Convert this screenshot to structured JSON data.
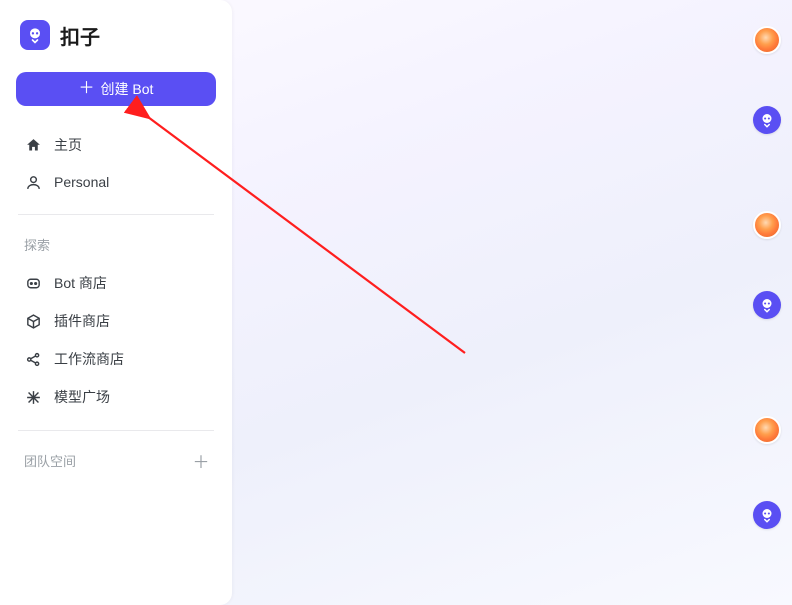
{
  "brand": {
    "name": "扣子"
  },
  "create_button": {
    "label": "创建 Bot"
  },
  "nav": {
    "primary": [
      {
        "label": "主页",
        "icon": "home-icon"
      },
      {
        "label": "Personal",
        "icon": "person-icon"
      }
    ],
    "explore_section_label": "探索",
    "explore": [
      {
        "label": "Bot 商店",
        "icon": "bot-icon"
      },
      {
        "label": "插件商店",
        "icon": "cube-icon"
      },
      {
        "label": "工作流商店",
        "icon": "share-icon"
      },
      {
        "label": "模型广场",
        "icon": "sparkle-icon"
      }
    ],
    "team_section_label": "团队空间"
  },
  "dock": {
    "items": [
      {
        "kind": "avatar",
        "name": "balloon-avatar"
      },
      {
        "kind": "logo",
        "name": "app-logo"
      },
      {
        "kind": "avatar",
        "name": "balloon-avatar"
      },
      {
        "kind": "logo",
        "name": "app-logo"
      },
      {
        "kind": "avatar",
        "name": "balloon-avatar"
      },
      {
        "kind": "logo",
        "name": "app-logo"
      }
    ]
  },
  "colors": {
    "accent": "#5a4ff3",
    "arrow": "#ff1e1e"
  }
}
